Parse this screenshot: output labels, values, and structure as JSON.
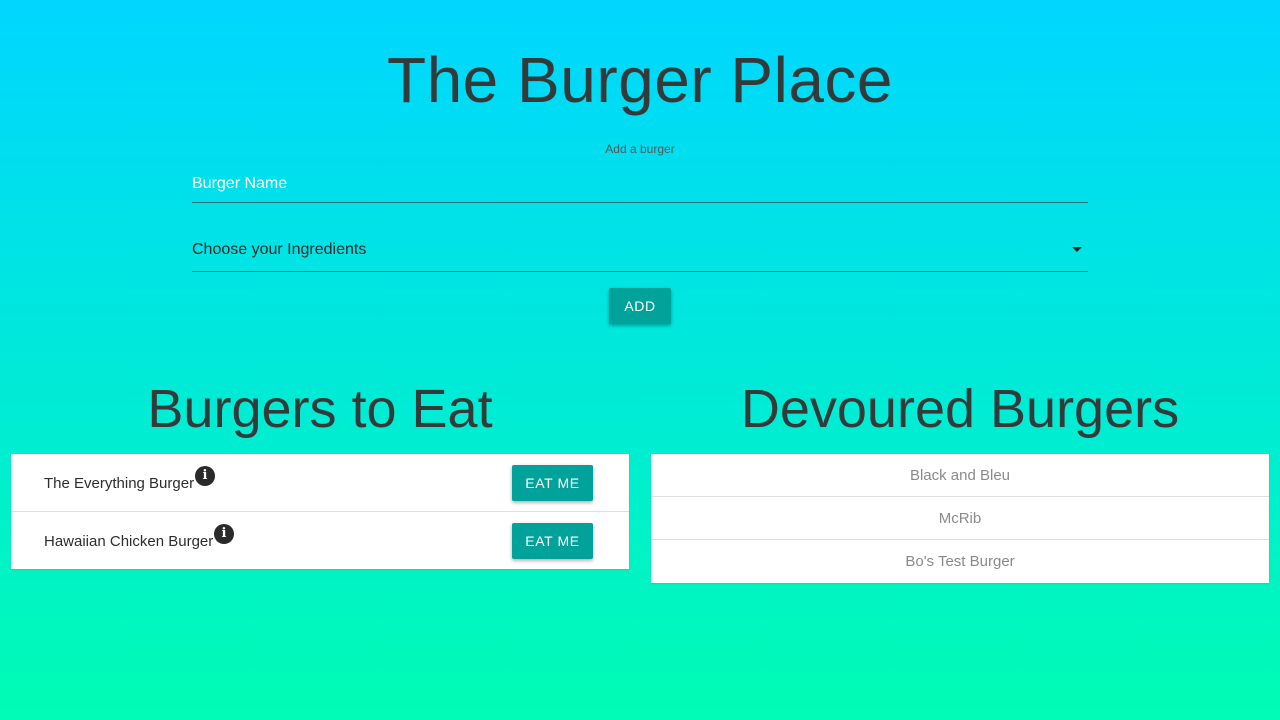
{
  "header": {
    "title": "The Burger Place"
  },
  "form": {
    "label": "Add a burger",
    "name_placeholder": "Burger Name",
    "name_value": "",
    "ingredients_select": "Choose your Ingredients",
    "add_label": "ADD"
  },
  "to_eat": {
    "title": "Burgers to Eat",
    "items": [
      {
        "name": "The Everything Burger",
        "info_icon": "info-icon",
        "button_label": "EAT ME"
      },
      {
        "name": "Hawaiian Chicken Burger",
        "info_icon": "info-icon",
        "button_label": "EAT ME"
      }
    ]
  },
  "devoured": {
    "title": "Devoured Burgers",
    "items": [
      "Black and Bleu",
      "McRib",
      "Bo's Test Burger"
    ]
  },
  "colors": {
    "gradient_top": "#00d6ff",
    "gradient_bottom": "#00fcb4",
    "button": "#00a29a",
    "title_text": "#333a3a"
  }
}
